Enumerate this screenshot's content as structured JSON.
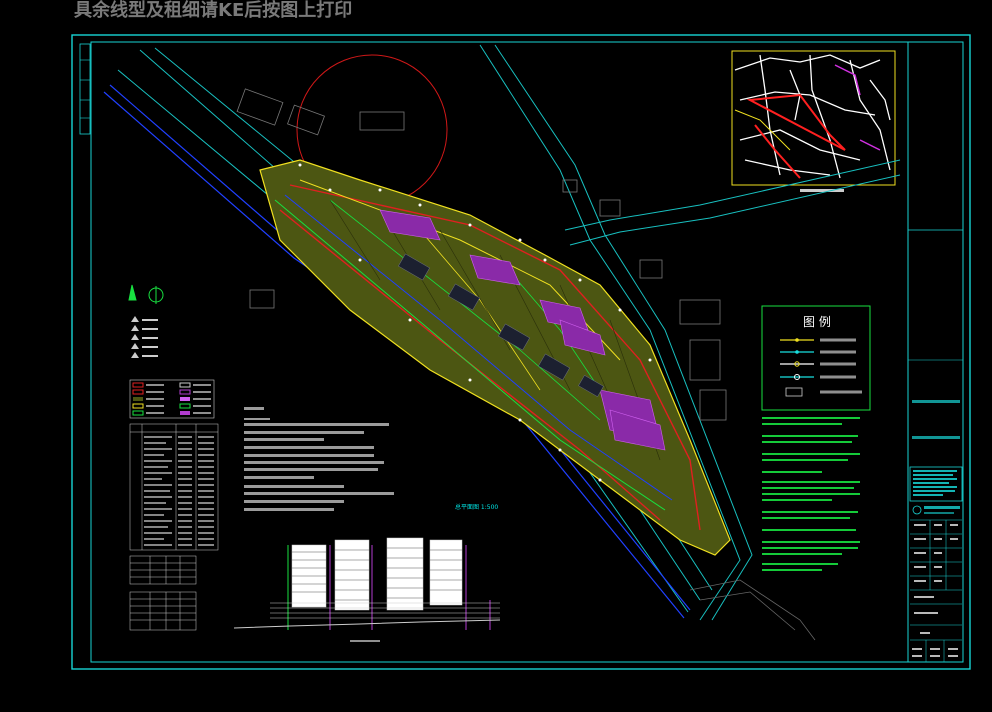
{
  "page": {
    "heading": "具余线型及租细请KE后按图上打印"
  },
  "drawing": {
    "scale_label": "总平面图 1:500",
    "colors": {
      "frame": "#18d4d4",
      "site_fill": "#4c5612",
      "building_magenta": "#b23cd0",
      "road_red": "#e02020",
      "pipe_green": "#18e040",
      "pipe_yellow": "#f0e020",
      "pipe_blue": "#2040ff",
      "highlight_red": "#ff2020"
    },
    "legend": {
      "title": "图 例"
    }
  }
}
